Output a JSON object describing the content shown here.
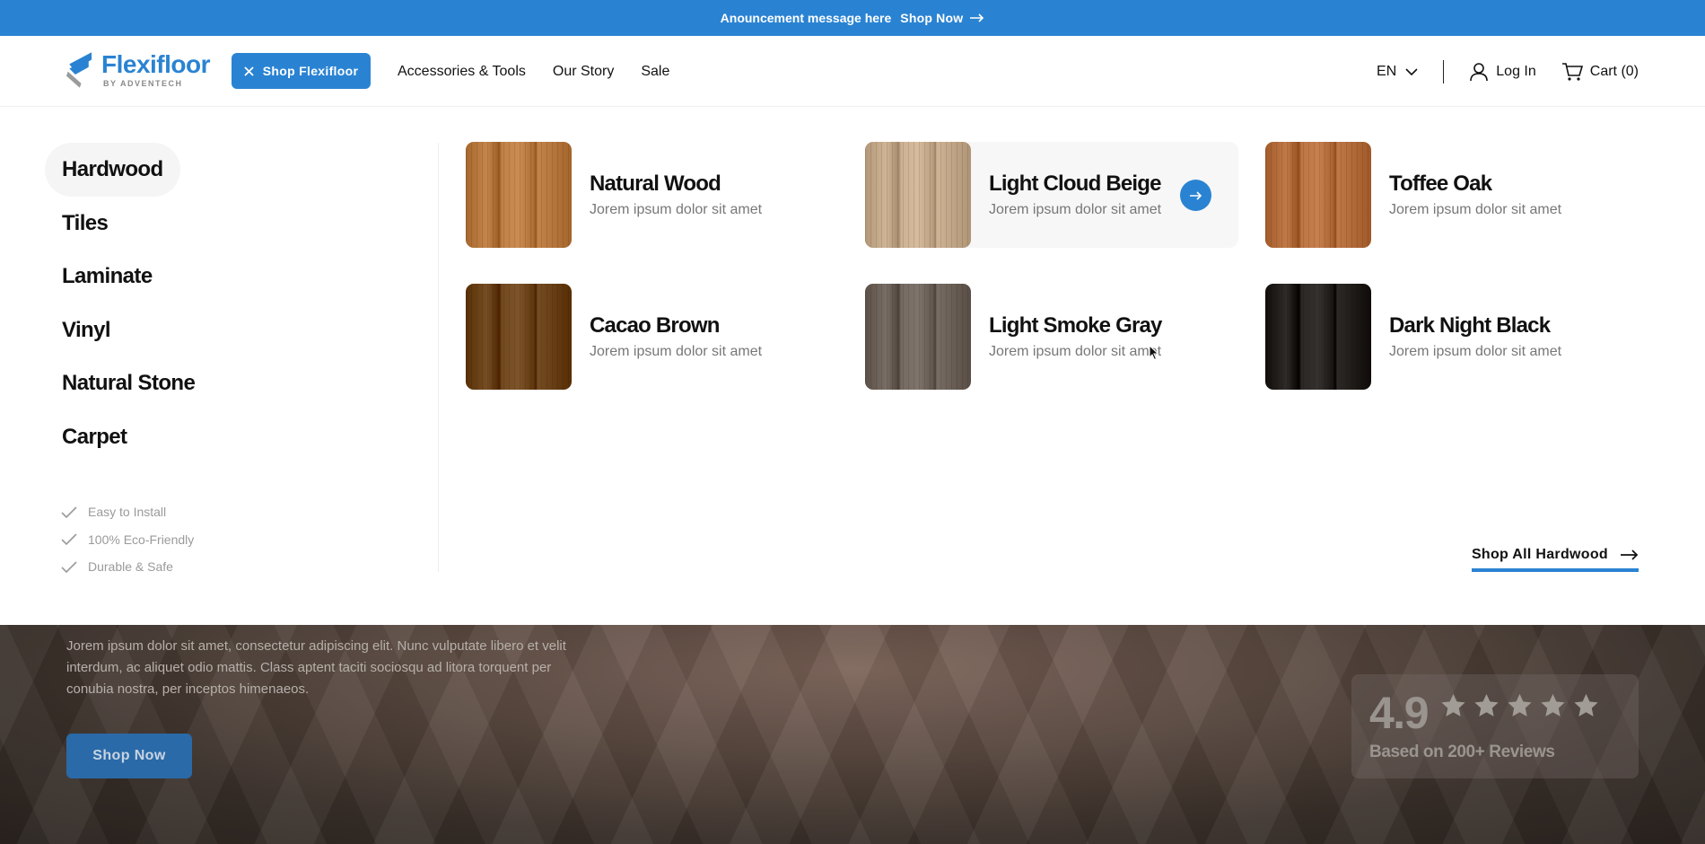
{
  "announcement": {
    "message": "Anouncement message here",
    "link_label": "Shop Now"
  },
  "header": {
    "logo": {
      "name": "Flexifloor",
      "sub": "BY ADVENTECH"
    },
    "shop_button": "Shop Flexifloor",
    "nav": [
      "Accessories & Tools",
      "Our Story",
      "Sale"
    ],
    "language": "EN",
    "login": "Log In",
    "cart": "Cart (0)"
  },
  "mega_menu": {
    "categories": [
      "Hardwood",
      "Tiles",
      "Laminate",
      "Vinyl",
      "Natural Stone",
      "Carpet"
    ],
    "active_category": "Hardwood",
    "features": [
      "Easy to Install",
      "100% Eco-Friendly",
      "Durable & Safe"
    ],
    "products": [
      {
        "name": "Natural Wood",
        "sub": "Jorem ipsum dolor sit amet",
        "color": "#b9793f"
      },
      {
        "name": "Light Cloud Beige",
        "sub": "Jorem ipsum dolor sit amet",
        "color": "#c4a98a"
      },
      {
        "name": "Toffee Oak",
        "sub": "Jorem ipsum dolor sit amet",
        "color": "#b56d3c"
      },
      {
        "name": "Cacao Brown",
        "sub": "Jorem ipsum dolor sit amet",
        "color": "#6b4218"
      },
      {
        "name": "Light Smoke Gray",
        "sub": "Jorem ipsum dolor sit amet",
        "color": "#6d6259"
      },
      {
        "name": "Dark Night Black",
        "sub": "Jorem ipsum dolor sit amet",
        "color": "#231f1c"
      }
    ],
    "shop_all": "Shop All Hardwood"
  },
  "hero": {
    "text": "Jorem ipsum dolor sit amet, consectetur adipiscing elit. Nunc vulputate libero et velit interdum, ac aliquet odio mattis. Class aptent taciti sociosqu ad litora torquent per conubia nostra, per inceptos himenaeos.",
    "button": "Shop Now",
    "rating": {
      "score": "4.9",
      "stars": 5,
      "label": "Based on 200+ Reviews"
    }
  },
  "colors": {
    "accent": "#2a83d2"
  }
}
